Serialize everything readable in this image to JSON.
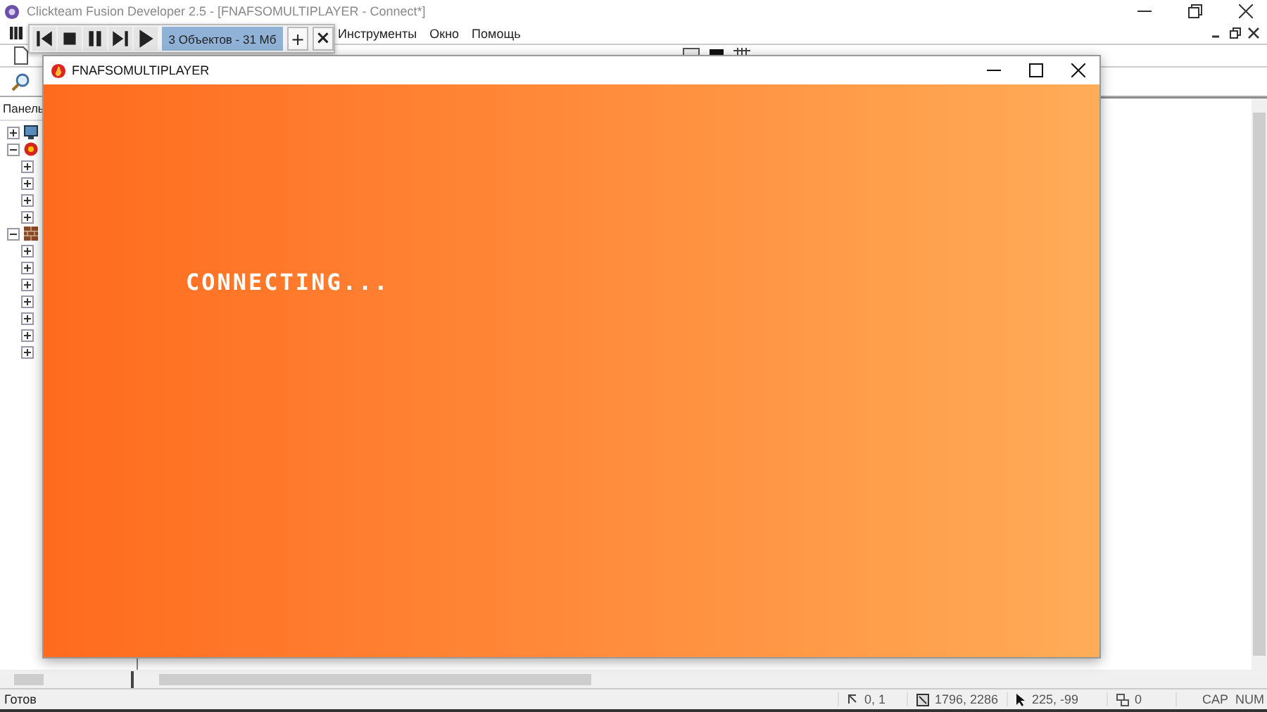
{
  "ide": {
    "title": "Clickteam Fusion Developer 2.5 - [FNAFSOMULTIPLAYER - Connect*]"
  },
  "menu": [
    "Инструменты",
    "Окно",
    "Помощь"
  ],
  "run_toolbar": {
    "status": "3 Объектов - 31 Мб",
    "add": "+",
    "close": "×"
  },
  "panel": {
    "title": "Панель",
    "tree": [
      {
        "kind": "monitor",
        "expanded": false
      },
      {
        "kind": "ball",
        "expanded": true,
        "children": [
          {
            "expanded": false
          },
          {
            "expanded": false
          },
          {
            "expanded": false
          },
          {
            "expanded": false
          }
        ]
      },
      {
        "kind": "bricks",
        "expanded": true,
        "children": [
          {
            "expanded": false
          },
          {
            "expanded": false
          },
          {
            "expanded": false
          },
          {
            "expanded": false
          },
          {
            "expanded": false
          },
          {
            "expanded": false
          },
          {
            "expanded": false
          }
        ]
      }
    ]
  },
  "game_window": {
    "title": "FNAFSOMULTIPLAYER",
    "message": "CONNECTING..."
  },
  "status_bar": {
    "text": "Готов",
    "fields": [
      {
        "kind": "origin",
        "value": "0, 1"
      },
      {
        "kind": "size",
        "value": "1796, 2286"
      },
      {
        "kind": "cursor",
        "value": "225, -99"
      },
      {
        "kind": "layers",
        "value": "0"
      }
    ],
    "keys": [
      "CAP",
      "NUM"
    ]
  }
}
